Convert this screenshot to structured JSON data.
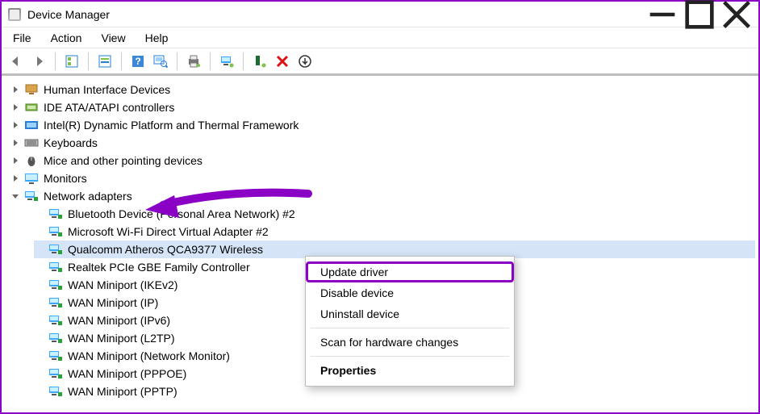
{
  "window": {
    "title": "Device Manager"
  },
  "menubar": [
    "File",
    "Action",
    "View",
    "Help"
  ],
  "tree": {
    "categories": [
      {
        "label": "Human Interface Devices",
        "expanded": false,
        "icon": "hid"
      },
      {
        "label": "IDE ATA/ATAPI controllers",
        "expanded": false,
        "icon": "ide"
      },
      {
        "label": "Intel(R) Dynamic Platform and Thermal Framework",
        "expanded": false,
        "icon": "intel"
      },
      {
        "label": "Keyboards",
        "expanded": false,
        "icon": "keyboard"
      },
      {
        "label": "Mice and other pointing devices",
        "expanded": false,
        "icon": "mouse"
      },
      {
        "label": "Monitors",
        "expanded": false,
        "icon": "monitor"
      }
    ],
    "networkAdapters": {
      "label": "Network adapters",
      "expanded": true,
      "children": [
        "Bluetooth Device (Personal Area Network) #2",
        "Microsoft Wi-Fi Direct Virtual Adapter #2",
        "Qualcomm Atheros QCA9377 Wireless",
        "Realtek PCIe GBE Family Controller",
        "WAN Miniport (IKEv2)",
        "WAN Miniport (IP)",
        "WAN Miniport (IPv6)",
        "WAN Miniport (L2TP)",
        "WAN Miniport (Network Monitor)",
        "WAN Miniport (PPPOE)",
        "WAN Miniport (PPTP)"
      ],
      "selectedIndex": 2
    }
  },
  "contextMenu": {
    "items": [
      "Update driver",
      "Disable device",
      "Uninstall device",
      "Scan for hardware changes",
      "Properties"
    ],
    "highlightedIndex": 0,
    "boldIndex": 4
  }
}
